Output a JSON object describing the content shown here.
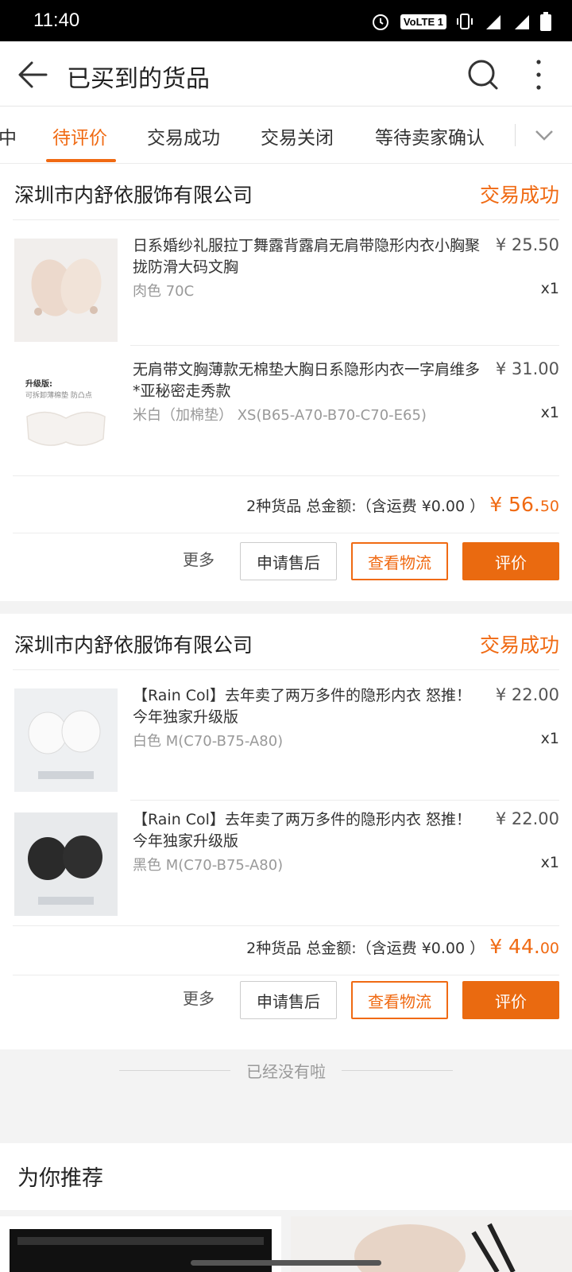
{
  "status_bar": {
    "time": "11:40",
    "volte": "VoLTE 1"
  },
  "app_bar": {
    "title": "已买到的货品"
  },
  "tabs": [
    {
      "label": "中"
    },
    {
      "label": "待评价"
    },
    {
      "label": "交易成功"
    },
    {
      "label": "交易关闭"
    },
    {
      "label": "等待卖家确认"
    }
  ],
  "orders": [
    {
      "shop": "深圳市内舒依服饰有限公司",
      "status": "交易成功",
      "items": [
        {
          "title": "日系婚纱礼服拉丁舞露背露肩无肩带隐形内衣小胸聚拢防滑大码文胸",
          "spec": "肉色 70C",
          "price": "¥ 25.50",
          "qty": "x1"
        },
        {
          "title": "无肩带文胸薄款无棉垫大胸日系隐形内衣一字肩维多*亚秘密走秀款",
          "spec": "米白（加棉垫） XS(B65-A70-B70-C70-E65)",
          "price": "¥ 31.00",
          "qty": "x1",
          "thumb_text_1": "升级版:",
          "thumb_text_2": "可拆卸薄棉垫   防凸点"
        }
      ],
      "summary_prefix": "2种货品 总金额:（含运费 ¥0.00 ）",
      "total_main": "¥ 56.",
      "total_cents": "50",
      "buttons": {
        "more": "更多",
        "after_sale": "申请售后",
        "logistics": "查看物流",
        "review": "评价"
      }
    },
    {
      "shop": "深圳市内舒依服饰有限公司",
      "status": "交易成功",
      "items": [
        {
          "title": "【Rain Col】去年卖了两万多件的隐形内衣 怒推！今年独家升级版",
          "spec": "白色 M(C70-B75-A80)",
          "price": "¥ 22.00",
          "qty": "x1"
        },
        {
          "title": "【Rain Col】去年卖了两万多件的隐形内衣 怒推！今年独家升级版",
          "spec": "黑色 M(C70-B75-A80)",
          "price": "¥ 22.00",
          "qty": "x1"
        }
      ],
      "summary_prefix": "2种货品 总金额:（含运费 ¥0.00 ）",
      "total_main": "¥ 44.",
      "total_cents": "00",
      "buttons": {
        "more": "更多",
        "after_sale": "申请售后",
        "logistics": "查看物流",
        "review": "评价"
      }
    }
  ],
  "no_more": "已经没有啦",
  "recommend": {
    "title": "为你推荐"
  },
  "colors": {
    "accent": "#f06a13"
  }
}
